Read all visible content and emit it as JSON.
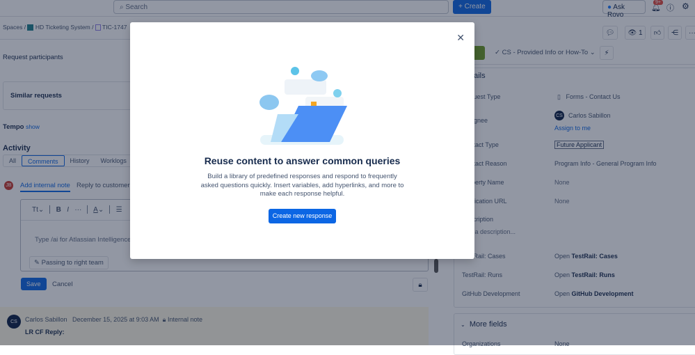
{
  "topbar": {
    "search_placeholder": "Search",
    "create_label": "Create",
    "ask_rovo_label": "Ask Rovo",
    "notifications_badge": "9+"
  },
  "breadcrumb": {
    "spaces": "Spaces",
    "project": "HD Ticketing System",
    "issue": "TIC-1747"
  },
  "left": {
    "request_participants": "Request participants",
    "similar_requests": "Similar requests",
    "tempo": "Tempo",
    "tempo_show": "show"
  },
  "activity": {
    "title": "Activity",
    "tabs": [
      "All",
      "Comments",
      "History",
      "Worklogs"
    ],
    "add_internal_note": "Add internal note",
    "reply_to_customer": "Reply to customer",
    "user_initials": "JB",
    "editor_placeholder": "Type /ai for Atlassian Intelligence",
    "text_style": "Tt",
    "canned_response": "Passing to right team",
    "save_label": "Save",
    "cancel_label": "Cancel"
  },
  "comment": {
    "initials": "CS",
    "author": "Carlos Sabillon",
    "timestamp": "December 15, 2025 at 9:03 AM",
    "visibility": "Internal note",
    "body": "LR CF Reply:"
  },
  "header_actions": {
    "watchers": "1",
    "status": "CS - Provided Info or How-To"
  },
  "details": {
    "title": "Details",
    "fields": [
      {
        "label": "Request Type",
        "value": "Forms - Contact Us"
      },
      {
        "label": "Assignee",
        "value": "Carlos Sabillon",
        "initials": "CS",
        "link": "Assign to me"
      },
      {
        "label": "Contact Type",
        "value": "Future Applicant"
      },
      {
        "label": "Contact Reason",
        "value": "Program Info - General Program Info"
      },
      {
        "label": "Property Name",
        "value": "None"
      },
      {
        "label": "Application URL",
        "value": "None"
      },
      {
        "label": "Description",
        "value": "Add a description..."
      },
      {
        "label": "TestRail: Cases",
        "prefix": "Open",
        "value": "TestRail: Cases"
      },
      {
        "label": "TestRail: Runs",
        "prefix": "Open",
        "value": "TestRail: Runs"
      },
      {
        "label": "GitHub Development",
        "prefix": "Open",
        "value": "GitHub Development"
      }
    ],
    "more_fields": "More fields",
    "organizations_label": "Organizations",
    "organizations_value": "None"
  },
  "modal": {
    "title": "Reuse content to answer common queries",
    "description": "Build a library of predefined responses and respond to frequently asked questions quickly. Insert variables, add hyperlinks, and more to make each response helpful.",
    "button": "Create new response"
  }
}
